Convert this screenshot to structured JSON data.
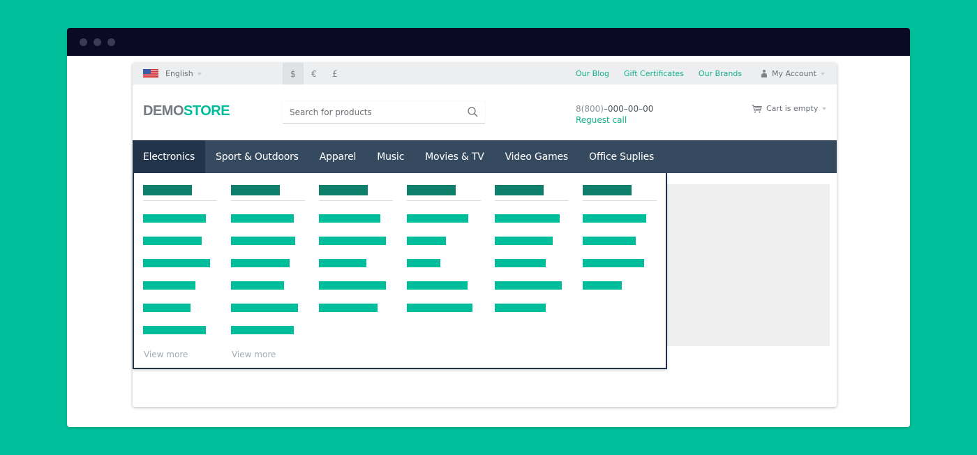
{
  "window": {
    "controls": [
      "close",
      "minimize",
      "maximize"
    ]
  },
  "topbar": {
    "language": {
      "label": "English",
      "flag": "us-flag-icon"
    },
    "currencies": [
      {
        "symbol": "$",
        "active": true
      },
      {
        "symbol": "€",
        "active": false
      },
      {
        "symbol": "£",
        "active": false
      }
    ],
    "links": [
      "Our Blog",
      "Gift Certificates",
      "Our Brands"
    ],
    "account": "My Account"
  },
  "header": {
    "logo_part1": "DEMO",
    "logo_part2": "STORE",
    "search_placeholder": "Search for products",
    "phone_code": "8(800)",
    "phone_number": "–000–00–00",
    "request_call": "Reguest call",
    "cart": "Cart is empty"
  },
  "nav": {
    "items": [
      {
        "label": "Electronics",
        "active": true
      },
      {
        "label": "Sport & Outdoors",
        "active": false
      },
      {
        "label": "Apparel",
        "active": false
      },
      {
        "label": "Music",
        "active": false
      },
      {
        "label": "Movies & TV",
        "active": false
      },
      {
        "label": "Video Games",
        "active": false
      },
      {
        "label": "Office Suplies",
        "active": false
      }
    ]
  },
  "mega_menu": {
    "columns": [
      {
        "item_count": 6,
        "view_more": "View more"
      },
      {
        "item_count": 6,
        "view_more": "View more"
      },
      {
        "item_count": 5,
        "view_more": null
      },
      {
        "item_count": 5,
        "view_more": null
      },
      {
        "item_count": 5,
        "view_more": null
      },
      {
        "item_count": 4,
        "view_more": null
      }
    ]
  },
  "colors": {
    "background": "#00bf9a",
    "titlebar": "#0a0a24",
    "accent": "#00bd9c",
    "accent_dark": "#0e7f6b",
    "nav": "#354a5f",
    "nav_active": "#22344a",
    "link": "#14b08c"
  }
}
